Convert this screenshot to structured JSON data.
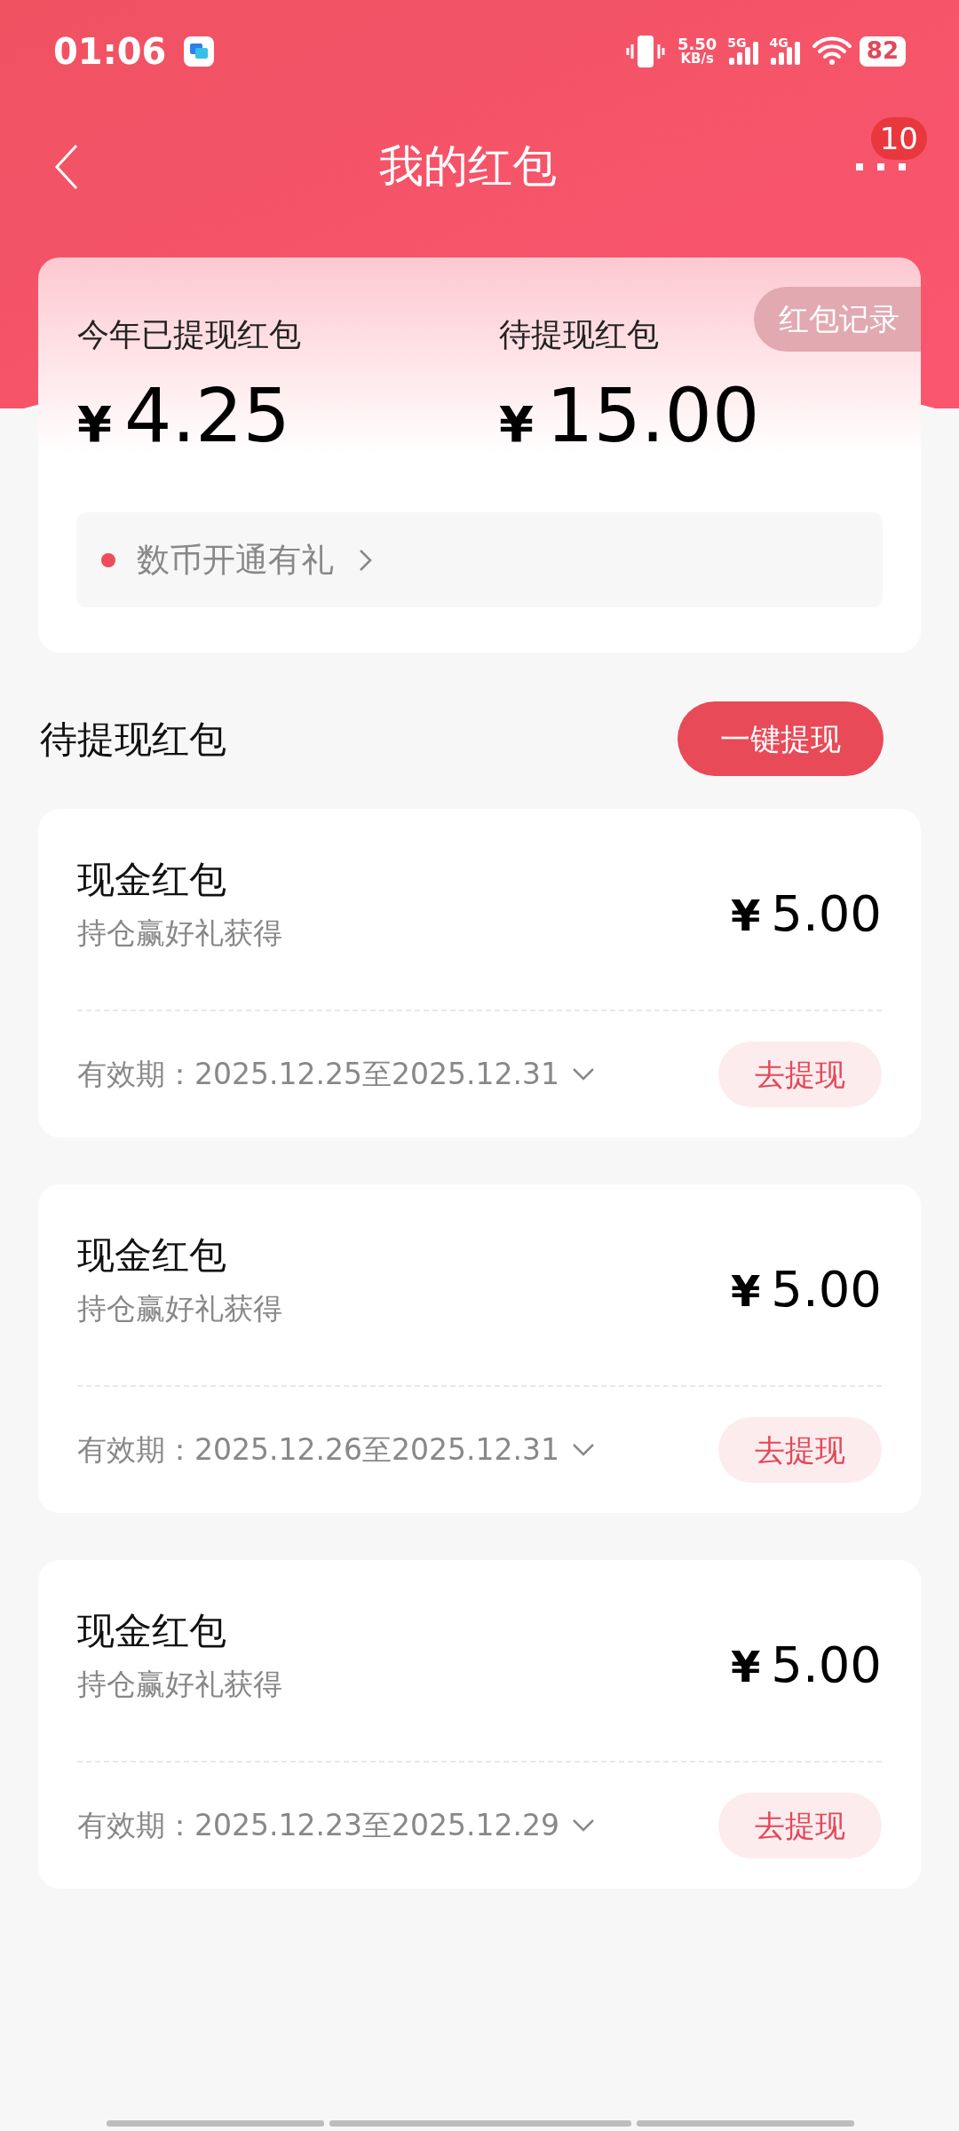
{
  "status_bar": {
    "time": "01:06",
    "net_speed": "5.50",
    "speed_unit": "KB/s",
    "network_1": "5G",
    "network_2": "4G",
    "battery": "82"
  },
  "header": {
    "title": "我的红包",
    "badge": "10"
  },
  "summary": {
    "record_button": "红包记录",
    "stats": [
      {
        "label": "今年已提现红包",
        "currency": "¥",
        "amount": "4.25"
      },
      {
        "label": "待提现红包",
        "currency": "¥",
        "amount": "15.00"
      }
    ],
    "promo": "数币开通有礼"
  },
  "section": {
    "title": "待提现红包",
    "button": "一键提现"
  },
  "cards": [
    {
      "title": "现金红包",
      "source": "持仓赢好礼获得",
      "currency": "¥",
      "amount": "5.00",
      "validity": "有效期：2025.12.25至2025.12.31",
      "button": "去提现"
    },
    {
      "title": "现金红包",
      "source": "持仓赢好礼获得",
      "currency": "¥",
      "amount": "5.00",
      "validity": "有效期：2025.12.26至2025.12.31",
      "button": "去提现"
    },
    {
      "title": "现金红包",
      "source": "持仓赢好礼获得",
      "currency": "¥",
      "amount": "5.00",
      "validity": "有效期：2025.12.23至2025.12.29",
      "button": "去提现"
    }
  ]
}
